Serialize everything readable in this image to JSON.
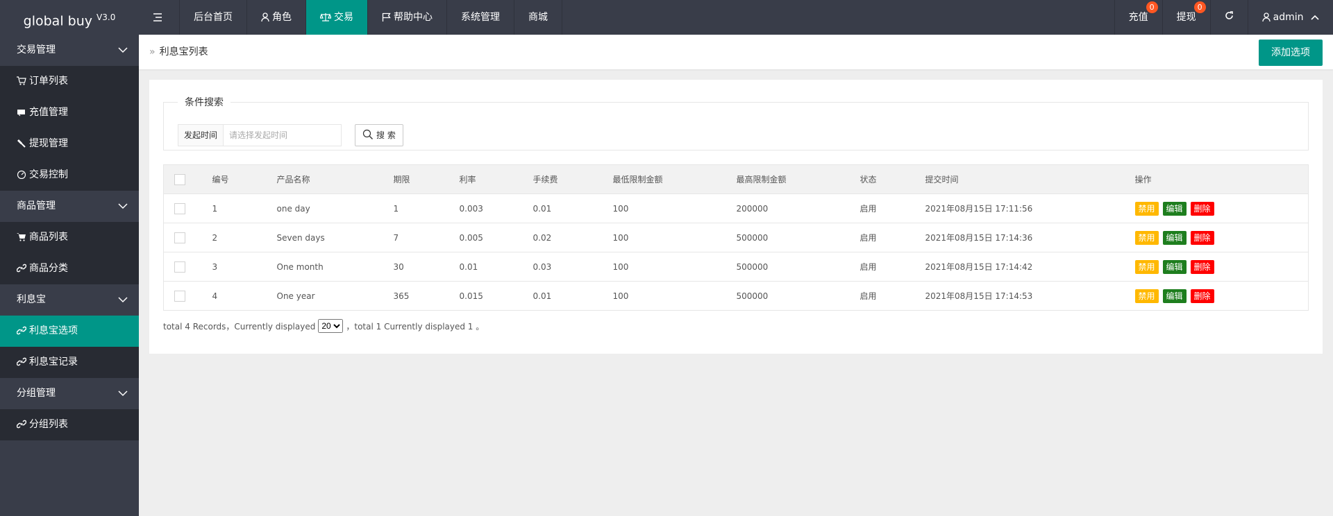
{
  "app": {
    "name": "global buy",
    "version": "V3.0"
  },
  "topnav": [
    {
      "label": "",
      "icon": "menu-icon"
    },
    {
      "label": "后台首页"
    },
    {
      "label": "角色",
      "icon": "user-icon"
    },
    {
      "label": "交易",
      "icon": "scale-icon",
      "active": true
    },
    {
      "label": "帮助中心",
      "icon": "flag-icon"
    },
    {
      "label": "系统管理"
    },
    {
      "label": "商城"
    }
  ],
  "topright": {
    "recharge": {
      "label": "充值",
      "badge": "0"
    },
    "withdraw": {
      "label": "提现",
      "badge": "0"
    },
    "user": "admin"
  },
  "sidebar": {
    "groups": [
      {
        "label": "交易管理",
        "items": [
          "订单列表",
          "充值管理",
          "提现管理",
          "交易控制"
        ]
      },
      {
        "label": "商品管理",
        "items": [
          "商品列表",
          "商品分类"
        ]
      },
      {
        "label": "利息宝",
        "items": [
          "利息宝选项",
          "利息宝记录"
        ]
      },
      {
        "label": "分组管理",
        "items": [
          "分组列表"
        ]
      }
    ]
  },
  "breadcrumb": "利息宝列表",
  "add_button": "添加选项",
  "search": {
    "legend": "条件搜索",
    "label": "发起时间",
    "placeholder": "请选择发起时间",
    "button": "搜 索"
  },
  "table": {
    "headers": [
      "编号",
      "产品名称",
      "期限",
      "利率",
      "手续费",
      "最低限制金额",
      "最高限制金额",
      "状态",
      "提交时间",
      "操作"
    ],
    "rows": [
      [
        "1",
        "one day",
        "1",
        "0.003",
        "0.01",
        "100",
        "200000",
        "启用",
        "2021年08月15日 17:11:56"
      ],
      [
        "2",
        "Seven days",
        "7",
        "0.005",
        "0.02",
        "100",
        "500000",
        "启用",
        "2021年08月15日 17:14:36"
      ],
      [
        "3",
        "One month",
        "30",
        "0.01",
        "0.03",
        "100",
        "500000",
        "启用",
        "2021年08月15日 17:14:42"
      ],
      [
        "4",
        "One year",
        "365",
        "0.015",
        "0.01",
        "100",
        "500000",
        "启用",
        "2021年08月15日 17:14:53"
      ]
    ],
    "actions": {
      "disable": "禁用",
      "edit": "编辑",
      "delete": "删除"
    }
  },
  "pager": {
    "prefix": "total 4 Records，Currently displayed",
    "page_size": "20",
    "suffix": "，total 1 Currently displayed 1 。"
  },
  "colors": {
    "accent": "#009688",
    "topbar": "#393d49",
    "warn": "#ffb800",
    "danger": "#ff0000",
    "edit": "#1e7e1e"
  }
}
